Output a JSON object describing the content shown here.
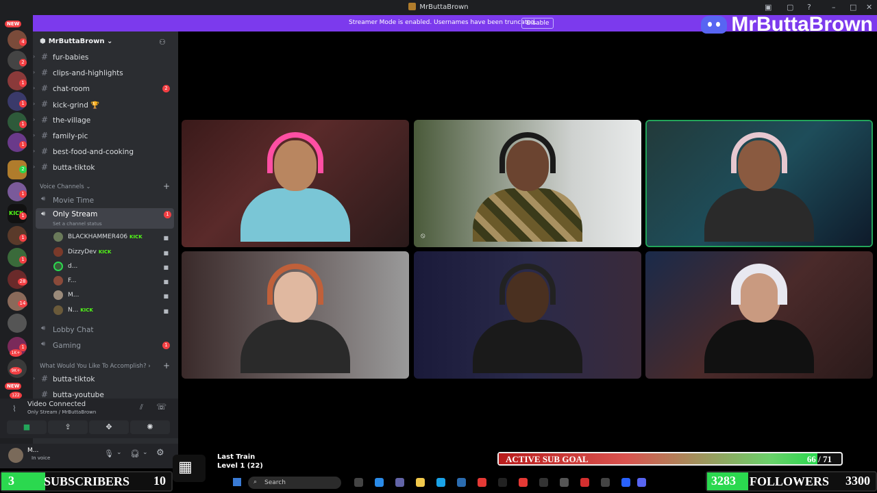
{
  "window": {
    "title": "MrButtaBrown"
  },
  "banner": {
    "message": "Streamer Mode is enabled. Usernames have been truncated.",
    "button": "Disable"
  },
  "brand": {
    "name": "MrButtaBrown"
  },
  "server_rail": {
    "new_label": "NEW",
    "badges": [
      "4",
      "2",
      "1",
      "1",
      "1",
      "1",
      "2",
      "1",
      "1",
      "1",
      "1",
      "1",
      "28",
      "14",
      "1",
      "1",
      "1K+",
      "9K+",
      "122"
    ]
  },
  "sidebar": {
    "guild_name": "MrButtaBrown",
    "text_channels": [
      {
        "name": "fur-babies"
      },
      {
        "name": "clips-and-highlights"
      },
      {
        "name": "chat-room",
        "badge": "2"
      },
      {
        "name": "kick-grind 🏆"
      },
      {
        "name": "the-village"
      },
      {
        "name": "family-pic"
      },
      {
        "name": "best-food-and-cooking"
      },
      {
        "name": "butta-tiktok"
      }
    ],
    "voice_category": "Voice Channels",
    "voice_channels": {
      "movie_time": "Movie Time",
      "only_stream": "Only Stream",
      "only_stream_badge": "1",
      "status_hint": "Set a channel status",
      "lobby_chat": "Lobby Chat",
      "gaming": "Gaming",
      "gaming_badge": "1"
    },
    "voice_users": [
      {
        "name": "BLACKHAMMER406",
        "kick": "KICK"
      },
      {
        "name": "DizzyDev",
        "kick": "KICK"
      },
      {
        "name": "d...",
        "kick": ""
      },
      {
        "name": "F...",
        "kick": ""
      },
      {
        "name": "M...",
        "kick": ""
      },
      {
        "name": "N...",
        "kick": "KICK"
      }
    ],
    "category2": "What Would You Like To Accomplish?",
    "cat2_channels": [
      "butta-tiktok",
      "butta-youtube"
    ]
  },
  "voice_panel": {
    "status": "Video Connected",
    "location": "Only Stream / MrButtaBrown"
  },
  "user_panel": {
    "name": "M...",
    "status": "In voice"
  },
  "overlay": {
    "subs": {
      "current": "3",
      "label": "SUBSCRIBERS",
      "goal": "10",
      "progress": 0.3
    },
    "followers": {
      "current": "3283",
      "label": "FOLLOWERS",
      "goal": "3300",
      "progress": 0.9948
    },
    "sub_goal": {
      "label": "ACTIVE SUB GOAL",
      "count": "66 / 71",
      "progress": 0.93
    },
    "now_playing": {
      "title": "Last Train",
      "level": "Level 1  (22)"
    }
  },
  "taskbar": {
    "search_placeholder": "Search"
  },
  "colors": {
    "discord_dark": "#1e1f22",
    "sidebar": "#2b2d31",
    "accent": "#7c3aed",
    "blurple": "#5865f2",
    "kick_green": "#53fc18",
    "goal_green": "#2bd84f"
  }
}
